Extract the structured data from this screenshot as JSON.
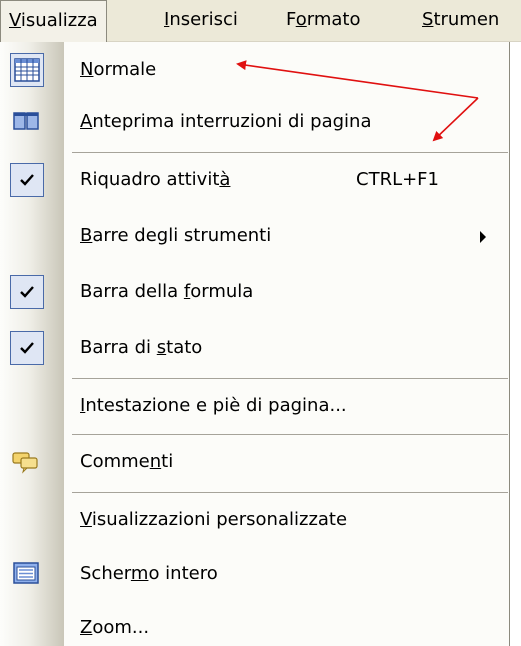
{
  "menubar": {
    "items": [
      {
        "first": "V",
        "rest": "isualizza"
      },
      {
        "first": "I",
        "rest": "nserisci"
      },
      {
        "first": "F",
        "second": "o",
        "rest": "rmato"
      },
      {
        "first": "S",
        "rest": "trumen"
      }
    ]
  },
  "menu": {
    "items": [
      {
        "pre": "",
        "u": "N",
        "post": "ormale",
        "icon": "normal-view-icon"
      },
      {
        "pre": "",
        "u": "A",
        "post": "nteprima interruzioni di pagina",
        "icon": "page-break-preview-icon"
      },
      {
        "pre": "Riquadro attivit",
        "u": "à",
        "post": "",
        "shortcut": "CTRL+F1",
        "icon": "check-icon"
      },
      {
        "pre": "",
        "u": "B",
        "post": "arre degli strumenti",
        "icon": "submenu-arrow-icon"
      },
      {
        "pre": "Barra della ",
        "u": "f",
        "post": "ormula",
        "icon": "check-icon"
      },
      {
        "pre": "Barra di ",
        "u": "s",
        "post": "tato",
        "icon": "check-icon"
      },
      {
        "pre": "",
        "u": "I",
        "post": "ntestazione e piè di pagina...",
        "icon": ""
      },
      {
        "pre": "Comme",
        "u": "n",
        "post": "ti",
        "icon": "comments-icon"
      },
      {
        "pre": "",
        "u": "V",
        "post": "isualizzazioni personalizzate",
        "icon": ""
      },
      {
        "pre": "Scher",
        "u": "m",
        "post": "o intero",
        "icon": "full-screen-icon"
      },
      {
        "pre": "",
        "u": "Z",
        "post": "oom...",
        "icon": ""
      }
    ]
  },
  "colors": {
    "menubar_bg": "#ece9d8",
    "check_bg": "#dfe6f4",
    "check_border": "#4a6aa8",
    "annotation_arrow": "#e01010"
  }
}
